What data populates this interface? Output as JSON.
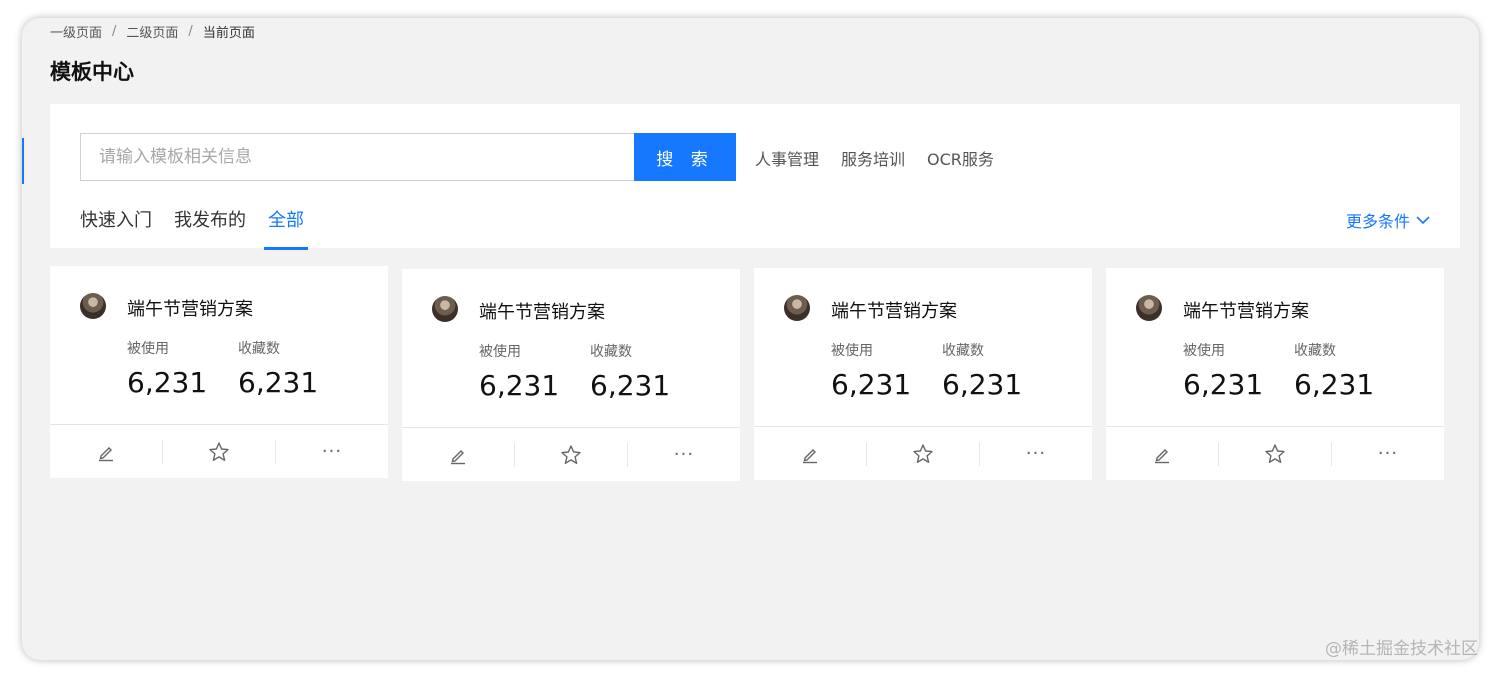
{
  "breadcrumb": {
    "level1": "一级页面",
    "level2": "二级页面",
    "current": "当前页面",
    "separator": "/"
  },
  "page_title": "模板中心",
  "search": {
    "placeholder": "请输入模板相关信息",
    "value": "",
    "button_label": "搜 索"
  },
  "quick_tags": [
    "人事管理",
    "服务培训",
    "OCR服务"
  ],
  "tabs": [
    {
      "label": "快速入门",
      "active": false
    },
    {
      "label": "我发布的",
      "active": false
    },
    {
      "label": "全部",
      "active": true
    }
  ],
  "more_filters": {
    "label": "更多条件",
    "icon": "chevron-down-icon"
  },
  "cards": [
    {
      "title": "端午节营销方案",
      "used_label": "被使用",
      "used_value": "6,231",
      "fav_label": "收藏数",
      "fav_value": "6,231",
      "actions": [
        "edit-icon",
        "star-icon",
        "more-icon"
      ]
    },
    {
      "title": "端午节营销方案",
      "used_label": "被使用",
      "used_value": "6,231",
      "fav_label": "收藏数",
      "fav_value": "6,231",
      "actions": [
        "edit-icon",
        "star-icon",
        "more-icon"
      ]
    },
    {
      "title": "端午节营销方案",
      "used_label": "被使用",
      "used_value": "6,231",
      "fav_label": "收藏数",
      "fav_value": "6,231",
      "actions": [
        "edit-icon",
        "star-icon",
        "more-icon"
      ]
    },
    {
      "title": "端午节营销方案",
      "used_label": "被使用",
      "used_value": "6,231",
      "fav_label": "收藏数",
      "fav_value": "6,231",
      "actions": [
        "edit-icon",
        "star-icon",
        "more-icon"
      ]
    }
  ],
  "watermark": "@稀土掘金技术社区",
  "colors": {
    "accent": "#1677ff",
    "background": "#f2f2f2",
    "panel": "#ffffff"
  }
}
